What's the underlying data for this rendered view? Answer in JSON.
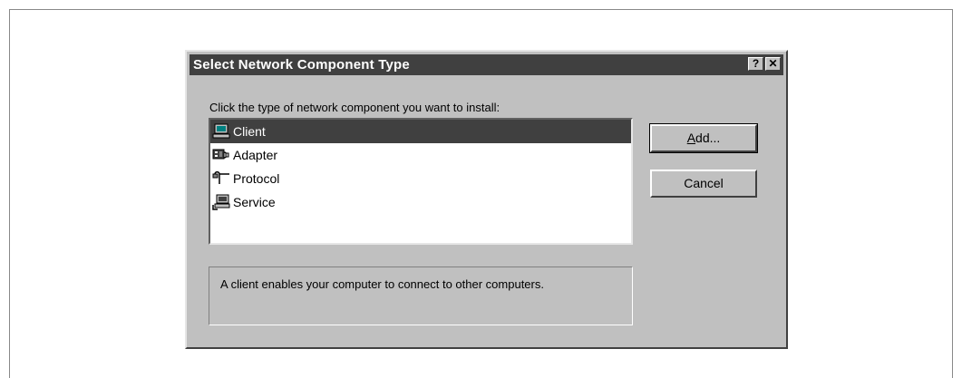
{
  "dialog": {
    "title": "Select Network Component Type",
    "help_label": "?",
    "close_label": "✕",
    "prompt": "Click the type of network component you want to install:",
    "components": [
      {
        "label": "Client",
        "icon": "client-computer-icon",
        "selected": true
      },
      {
        "label": "Adapter",
        "icon": "network-adapter-icon",
        "selected": false
      },
      {
        "label": "Protocol",
        "icon": "protocol-cable-icon",
        "selected": false
      },
      {
        "label": "Service",
        "icon": "service-computer-icon",
        "selected": false
      }
    ],
    "description": "A client enables your computer to connect to other computers.",
    "add_label": "Add...",
    "cancel_label": "Cancel"
  },
  "colors": {
    "dialog_face": "#c0c0c0",
    "titlebar": "#404040",
    "selection": "#404040"
  }
}
